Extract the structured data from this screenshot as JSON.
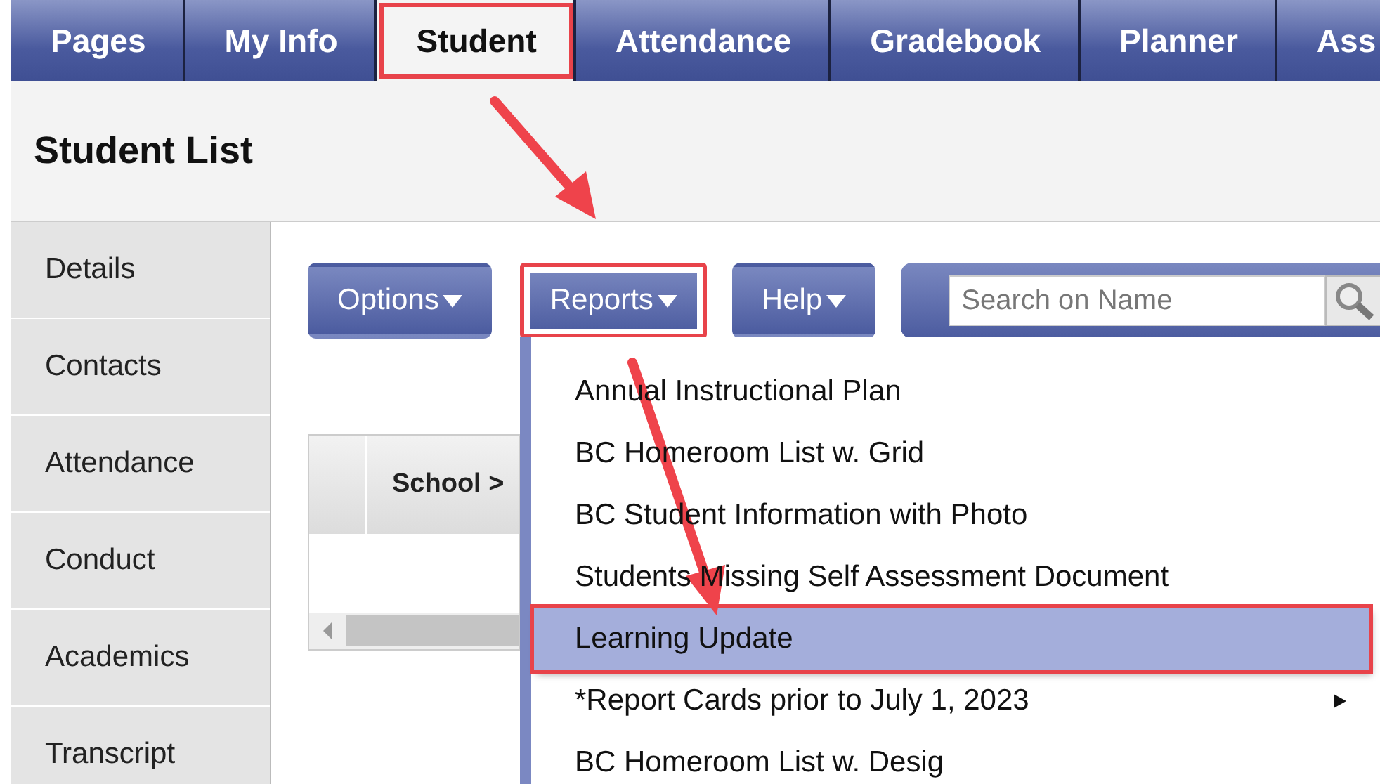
{
  "nav_tabs": [
    {
      "label": "Pages",
      "selected": false,
      "highlighted": false
    },
    {
      "label": "My Info",
      "selected": false,
      "highlighted": false
    },
    {
      "label": "Student",
      "selected": true,
      "highlighted": true
    },
    {
      "label": "Attendance",
      "selected": false,
      "highlighted": false
    },
    {
      "label": "Gradebook",
      "selected": false,
      "highlighted": false
    },
    {
      "label": "Planner",
      "selected": false,
      "highlighted": false
    },
    {
      "label": "Ass",
      "selected": false,
      "highlighted": false
    }
  ],
  "page_title": "Student List",
  "sidebar": {
    "items": [
      {
        "label": "Details"
      },
      {
        "label": "Contacts"
      },
      {
        "label": "Attendance"
      },
      {
        "label": "Conduct"
      },
      {
        "label": "Academics"
      },
      {
        "label": "Transcript"
      }
    ]
  },
  "toolbar": {
    "buttons": [
      {
        "label": "Options",
        "highlighted": false
      },
      {
        "label": "Reports",
        "highlighted": true
      },
      {
        "label": "Help",
        "highlighted": false
      }
    ],
    "search": {
      "placeholder": "Search on Name"
    }
  },
  "table": {
    "columns": [
      "School >"
    ]
  },
  "reports_menu": {
    "items": [
      {
        "label": "Annual Instructional Plan",
        "selected": false,
        "highlighted": false,
        "submenu": false
      },
      {
        "label": "BC Homeroom List w. Grid",
        "selected": false,
        "highlighted": false,
        "submenu": false
      },
      {
        "label": "BC Student Information with Photo",
        "selected": false,
        "highlighted": false,
        "submenu": false
      },
      {
        "label": "Students Missing Self Assessment Document",
        "selected": false,
        "highlighted": false,
        "submenu": false
      },
      {
        "label": "Learning Update",
        "selected": true,
        "highlighted": true,
        "submenu": false
      },
      {
        "label": "*Report Cards prior to July 1, 2023",
        "selected": false,
        "highlighted": false,
        "submenu": true
      },
      {
        "label": "BC Homeroom List w. Desig",
        "selected": false,
        "highlighted": false,
        "submenu": false
      }
    ]
  }
}
